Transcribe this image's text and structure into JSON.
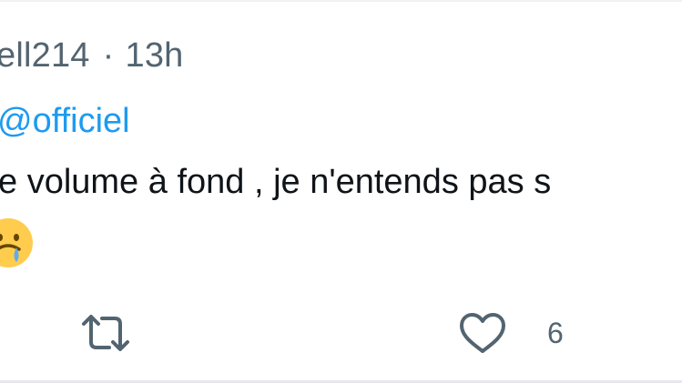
{
  "tweet": {
    "author_handle_partial": "ell214",
    "separator": "·",
    "time_ago": "13h",
    "mention": "@officiel",
    "text": "e volume à fond , je n'entends pas s",
    "emoji": "face-with-tear-icon"
  },
  "actions": {
    "retweet_icon": "retweet-icon",
    "like_icon": "heart-icon",
    "like_count": "6"
  },
  "colors": {
    "secondary_text": "#536471",
    "link": "#1d9bf0",
    "primary_text": "#0f1419",
    "emoji_yellow": "#ffcc4d",
    "tear_blue": "#5dadec"
  }
}
